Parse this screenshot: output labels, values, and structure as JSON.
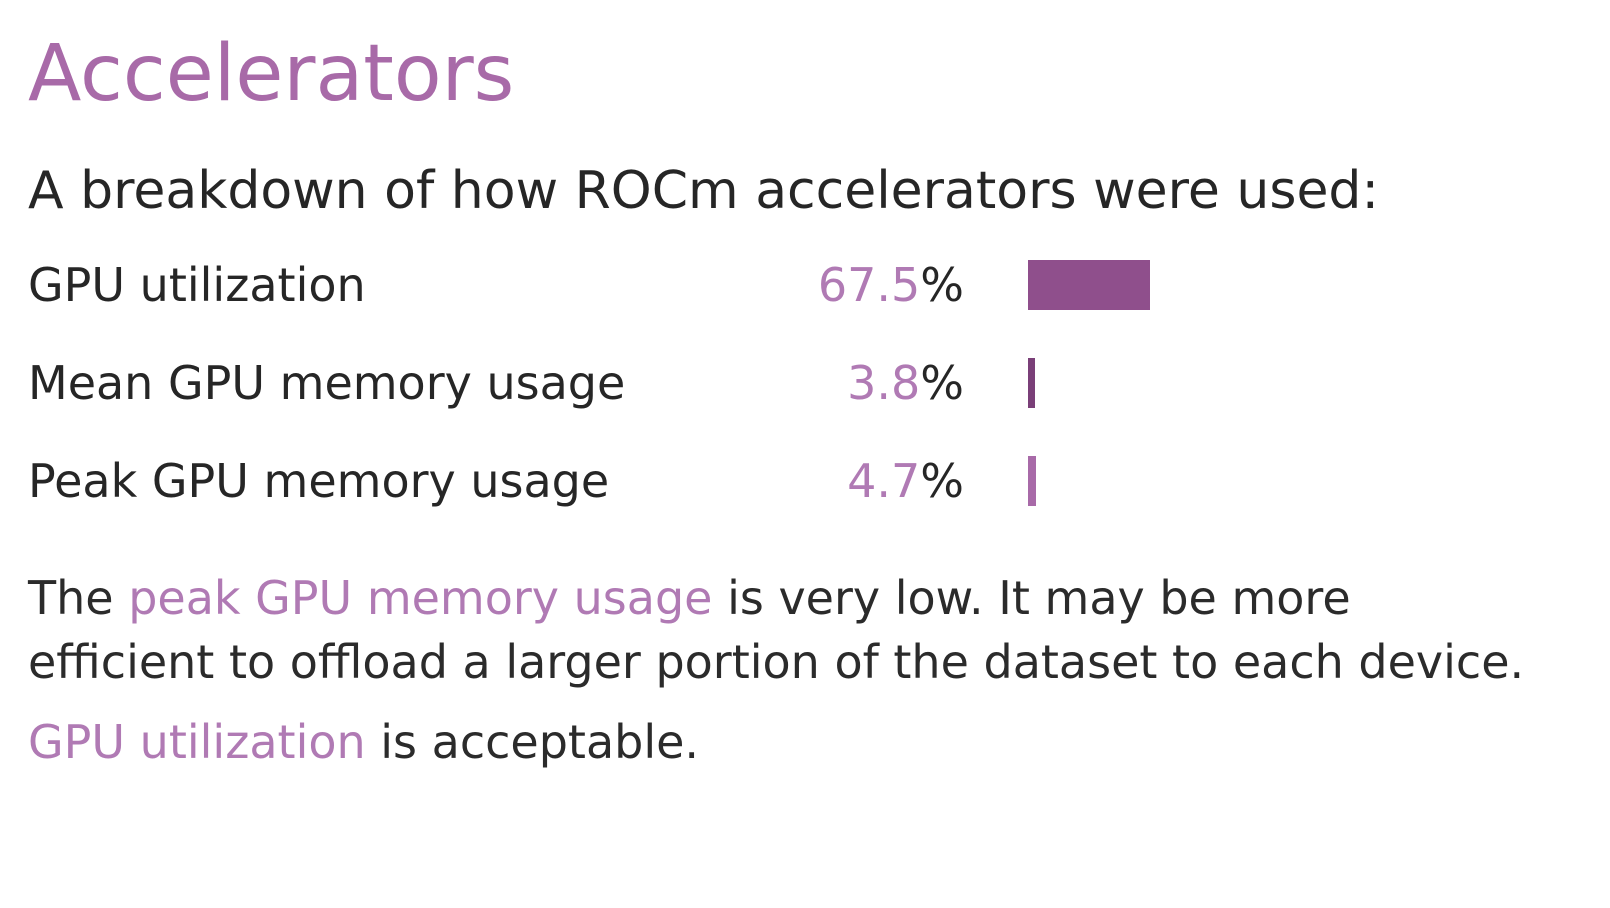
{
  "title": "Accelerators",
  "intro": "A breakdown of how ROCm accelerators were used:",
  "colors": {
    "title": "#a86aa8",
    "accent_text": "#b07ab4",
    "body_text": "#262626",
    "bar_primary": "#8f4f8c",
    "bar_dark": "#7a3f78",
    "bar_light": "#a86aa8"
  },
  "metrics": [
    {
      "label": "GPU utilization",
      "value": "67.5",
      "unit": "%",
      "percent": 67.5,
      "bar_color": "#8f4f8c"
    },
    {
      "label": "Mean GPU memory usage",
      "value": "3.8",
      "unit": "%",
      "percent": 3.8,
      "bar_color": "#7a3f78"
    },
    {
      "label": "Peak GPU memory usage",
      "value": "4.7",
      "unit": "%",
      "percent": 4.7,
      "bar_color": "#a86aa8"
    }
  ],
  "notes": [
    {
      "prefix": "The ",
      "highlight": "peak GPU memory usage",
      "suffix": " is very low. It may be more efficient to offload a larger portion of the dataset to each device."
    },
    {
      "prefix": "",
      "highlight": "GPU utilization",
      "suffix": " is acceptable."
    }
  ]
}
